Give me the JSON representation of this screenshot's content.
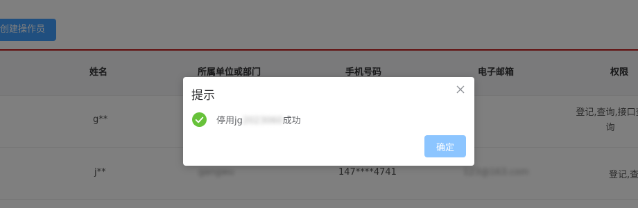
{
  "toolbar": {
    "create_label": "创建操作员"
  },
  "table": {
    "headers": [
      "姓名",
      "所属单位或部门",
      "手机号码",
      "电子邮箱",
      "权限"
    ],
    "rows": [
      {
        "name": "g**",
        "dept": "",
        "phone": "",
        "email": "",
        "perm_line1": "登记,查询,接口查",
        "perm_line2": "询"
      },
      {
        "name": "j**",
        "dept": "gangwu",
        "phone": "147****4741",
        "email": "123@163.com",
        "perm_line1": "登记,查",
        "perm_line2": ""
      }
    ]
  },
  "dialog": {
    "title": "提示",
    "message_prefix": "停用jg",
    "message_masked": "2023060",
    "message_suffix": "成功",
    "confirm_label": "确定",
    "success_color": "#67c23a"
  }
}
